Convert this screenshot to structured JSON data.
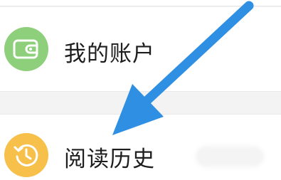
{
  "menu": {
    "items": [
      {
        "label": "我的账户",
        "icon": "wallet-icon",
        "icon_color": "#8dcf7a"
      },
      {
        "label": "阅读历史",
        "icon": "clock-history-icon",
        "icon_color": "#f6c04b"
      }
    ]
  },
  "annotation": {
    "type": "pointer-arrow",
    "color": "#2f8fe2",
    "points_to": "阅读历史"
  }
}
